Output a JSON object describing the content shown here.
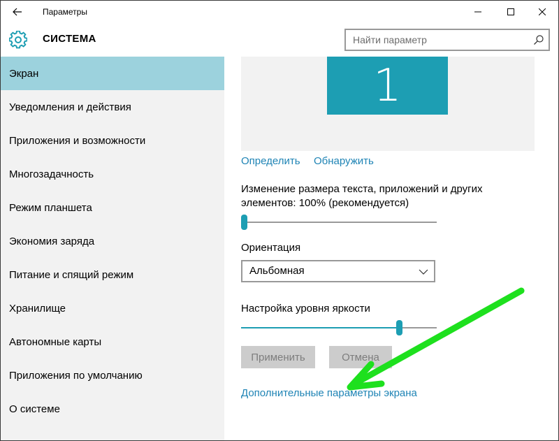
{
  "window": {
    "title": "Параметры"
  },
  "header": {
    "title": "СИСТЕМА",
    "search_placeholder": "Найти параметр"
  },
  "sidebar": {
    "items": [
      {
        "label": "Экран",
        "active": true
      },
      {
        "label": "Уведомления и действия"
      },
      {
        "label": "Приложения и возможности"
      },
      {
        "label": "Многозадачность"
      },
      {
        "label": "Режим планшета"
      },
      {
        "label": "Экономия заряда"
      },
      {
        "label": "Питание и спящий режим"
      },
      {
        "label": "Хранилище"
      },
      {
        "label": "Автономные карты"
      },
      {
        "label": "Приложения по умолчанию"
      },
      {
        "label": "О системе"
      }
    ]
  },
  "main": {
    "monitor_number": "1",
    "identify_link": "Определить",
    "detect_link": "Обнаружить",
    "scale_label": "Изменение размера текста, приложений и других элементов: 100% (рекомендуется)",
    "scale_level": 0.0,
    "orientation_label": "Ориентация",
    "orientation_value": "Альбомная",
    "brightness_label": "Настройка уровня яркости",
    "brightness_level": 0.82,
    "apply_button": "Применить",
    "cancel_button": "Отмена",
    "advanced_link": "Дополнительные параметры экрана"
  },
  "colors": {
    "accent": "#1d9eb3",
    "link": "#1f84b5",
    "sidebar_active": "#9cd2dd",
    "annotation_arrow": "#1ee01e"
  },
  "icons": {
    "back": "back-arrow-icon",
    "settings": "gear-icon",
    "search": "search-icon",
    "dropdown": "chevron-down-icon"
  }
}
